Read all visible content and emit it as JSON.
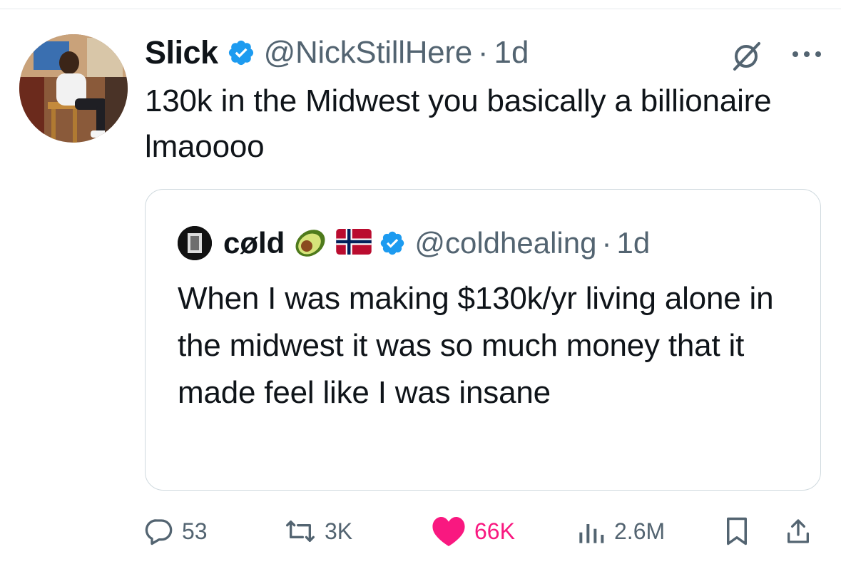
{
  "tweet": {
    "author_name": "Slick",
    "author_handle": "@NickStillHere",
    "separator": "·",
    "time": "1d",
    "text": "130k in the Midwest you basically a billionaire lmaoooo"
  },
  "quoted_tweet": {
    "author_name": "cøld",
    "author_handle": "@coldhealing",
    "separator": "·",
    "time": "1d",
    "text": "When I was making $130k/yr living alone in the midwest it was so much money that it made feel like I was insane"
  },
  "actions": {
    "replies": "53",
    "reposts": "3K",
    "likes": "66K",
    "views": "2.6M"
  },
  "colors": {
    "verified": "#1d9bf0",
    "like": "#f91880",
    "muted": "#536471",
    "text": "#0f1419",
    "border": "#cfd9de"
  },
  "icons": [
    "verified-badge-icon",
    "grok-icon",
    "more-icon",
    "avocado-emoji",
    "norway-flag-emoji",
    "reply-icon",
    "repost-icon",
    "like-icon",
    "views-icon",
    "bookmark-icon",
    "share-icon"
  ]
}
